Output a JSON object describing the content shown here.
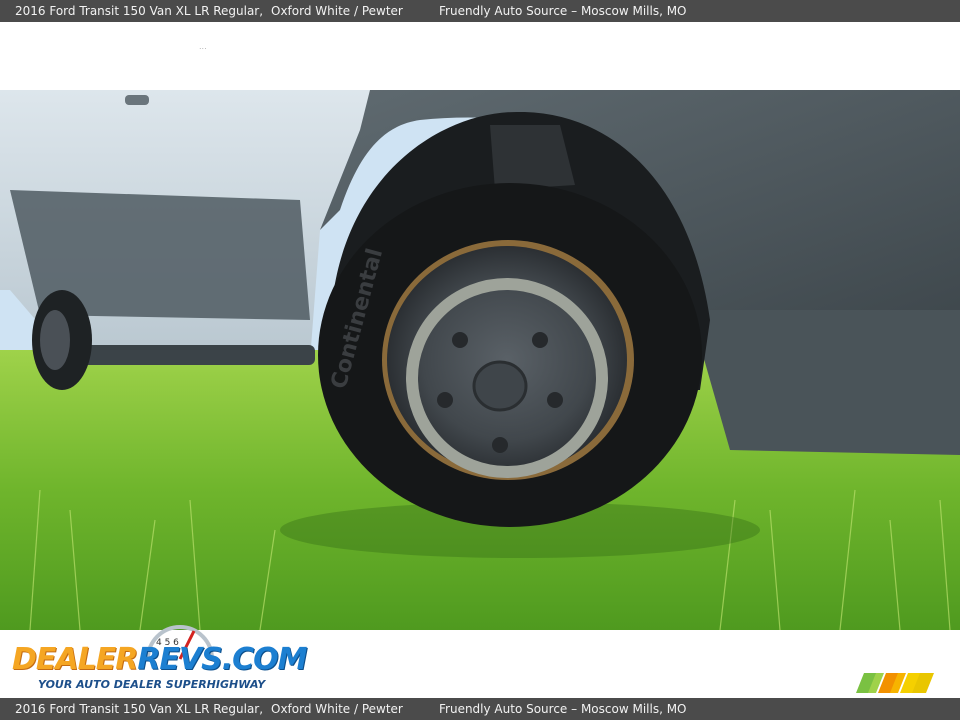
{
  "header": {
    "title": "2016 Ford Transit 150 Van XL LR Regular,",
    "color": "Oxford White / Pewter",
    "dealer": "Fruendly Auto Source – Moscow Mills, MO"
  },
  "hero": {
    "dots": "..."
  },
  "photo": {
    "subject": "front-wheel-tire",
    "tire_brand": "Continental"
  },
  "footer": {
    "logo_part1": "DEALER",
    "logo_part2": "REVS",
    "logo_part3": ".COM",
    "tagline": "YOUR AUTO DEALER SUPERHIGHWAY",
    "dial_numbers": "4 5 6",
    "title": "2016 Ford Transit 150 Van XL LR Regular,",
    "color": "Oxford White / Pewter",
    "dealer": "Fruendly Auto Source – Moscow Mills, MO"
  },
  "colors": {
    "bar_bg": "#4b4b4b",
    "logo_orange": "#f5a623",
    "logo_blue": "#1c7fd1",
    "stripe_green": "#7ac142",
    "stripe_orange": "#f29100",
    "stripe_yellow": "#f5d000"
  }
}
